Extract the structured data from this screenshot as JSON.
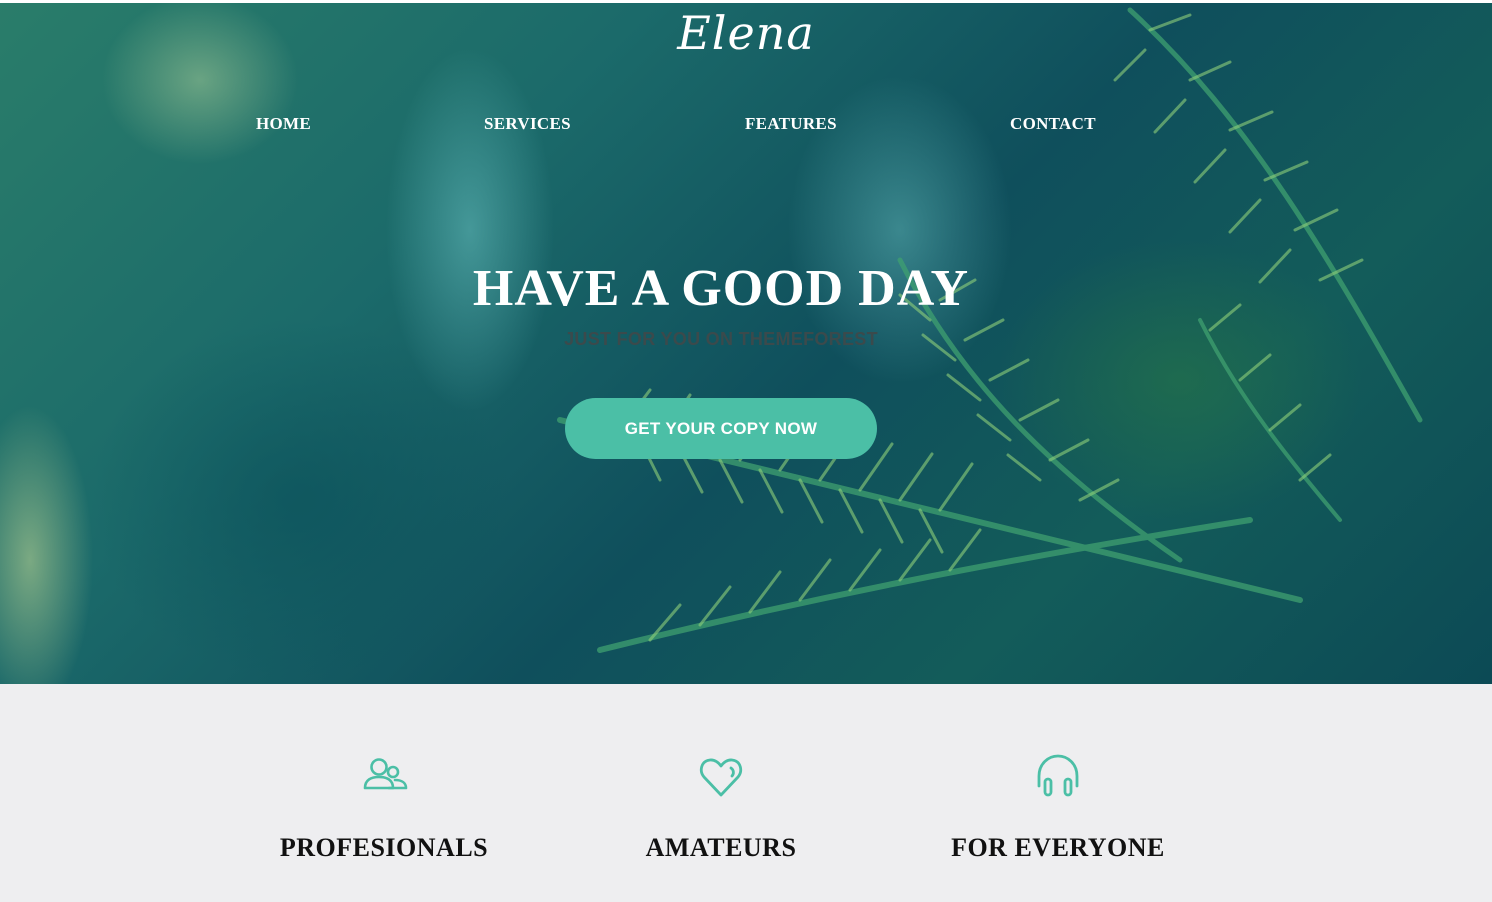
{
  "brand": {
    "logo_text": "Elena"
  },
  "nav": {
    "items": [
      {
        "label": "HOME"
      },
      {
        "label": "SERVICES"
      },
      {
        "label": "FEATURES"
      },
      {
        "label": "CONTACT"
      }
    ]
  },
  "hero": {
    "headline": "HAVE A GOOD DAY",
    "subline": "JUST FOR YOU ON THEMEFOREST",
    "cta_label": "GET YOUR COPY NOW"
  },
  "features": [
    {
      "icon": "users-icon",
      "title": "PROFESIONALS"
    },
    {
      "icon": "heart-icon",
      "title": "AMATEURS"
    },
    {
      "icon": "headphones-icon",
      "title": "FOR EVERYONE"
    }
  ],
  "colors": {
    "accent": "#4bbfa6",
    "features_background": "#eeeef0",
    "hero_dark": "#0f4f5c",
    "heading_dark": "#111111"
  }
}
